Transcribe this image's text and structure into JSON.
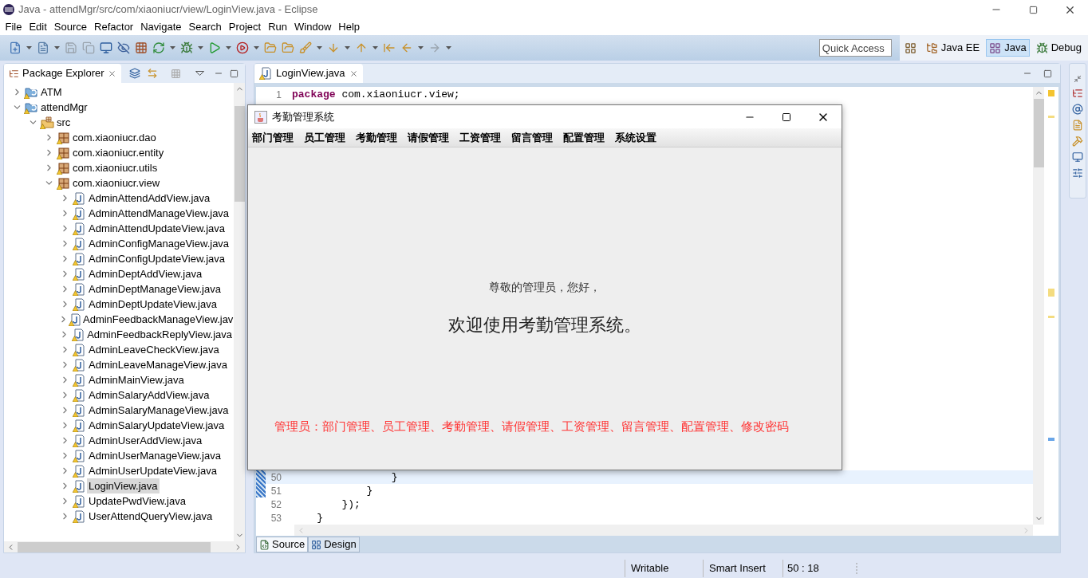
{
  "window": {
    "title": "Java - attendMgr/src/com/xiaoniucr/view/LoginView.java - Eclipse"
  },
  "menu": [
    "File",
    "Edit",
    "Source",
    "Refactor",
    "Navigate",
    "Search",
    "Project",
    "Run",
    "Window",
    "Help"
  ],
  "toolbar": {
    "quick_access": {
      "placeholder": "Quick Access"
    },
    "perspectives": [
      {
        "label": "Java EE",
        "kind": "javaee",
        "selected": false
      },
      {
        "label": "Java",
        "kind": "java",
        "selected": true
      },
      {
        "label": "Debug",
        "kind": "debug",
        "selected": false
      }
    ]
  },
  "package_explorer": {
    "title": "Package Explorer",
    "tree": [
      {
        "label": "ATM",
        "kind": "project",
        "expanded": false,
        "selected": false
      },
      {
        "label": "attendMgr",
        "kind": "project",
        "expanded": true,
        "selected": false,
        "children": [
          {
            "label": "src",
            "kind": "source_folder",
            "expanded": true,
            "selected": false,
            "children": [
              {
                "label": "com.xiaoniucr.dao",
                "kind": "package",
                "expanded": false,
                "selected": false
              },
              {
                "label": "com.xiaoniucr.entity",
                "kind": "package",
                "expanded": false,
                "selected": false
              },
              {
                "label": "com.xiaoniucr.utils",
                "kind": "package",
                "expanded": false,
                "selected": false
              },
              {
                "label": "com.xiaoniucr.view",
                "kind": "package",
                "expanded": true,
                "selected": false,
                "children": [
                  {
                    "label": "AdminAttendAddView.java",
                    "kind": "file",
                    "expanded": false,
                    "selected": false
                  },
                  {
                    "label": "AdminAttendManageView.java",
                    "kind": "file",
                    "expanded": false,
                    "selected": false
                  },
                  {
                    "label": "AdminAttendUpdateView.java",
                    "kind": "file",
                    "expanded": false,
                    "selected": false
                  },
                  {
                    "label": "AdminConfigManageView.java",
                    "kind": "file",
                    "expanded": false,
                    "selected": false
                  },
                  {
                    "label": "AdminConfigUpdateView.java",
                    "kind": "file",
                    "expanded": false,
                    "selected": false
                  },
                  {
                    "label": "AdminDeptAddView.java",
                    "kind": "file",
                    "expanded": false,
                    "selected": false
                  },
                  {
                    "label": "AdminDeptManageView.java",
                    "kind": "file",
                    "expanded": false,
                    "selected": false
                  },
                  {
                    "label": "AdminDeptUpdateView.java",
                    "kind": "file",
                    "expanded": false,
                    "selected": false
                  },
                  {
                    "label": "AdminFeedbackManageView.jav",
                    "kind": "file",
                    "expanded": false,
                    "selected": false
                  },
                  {
                    "label": "AdminFeedbackReplyView.java",
                    "kind": "file",
                    "expanded": false,
                    "selected": false
                  },
                  {
                    "label": "AdminLeaveCheckView.java",
                    "kind": "file",
                    "expanded": false,
                    "selected": false
                  },
                  {
                    "label": "AdminLeaveManageView.java",
                    "kind": "file",
                    "expanded": false,
                    "selected": false
                  },
                  {
                    "label": "AdminMainView.java",
                    "kind": "file",
                    "expanded": false,
                    "selected": false
                  },
                  {
                    "label": "AdminSalaryAddView.java",
                    "kind": "file",
                    "expanded": false,
                    "selected": false
                  },
                  {
                    "label": "AdminSalaryManageView.java",
                    "kind": "file",
                    "expanded": false,
                    "selected": false
                  },
                  {
                    "label": "AdminSalaryUpdateView.java",
                    "kind": "file",
                    "expanded": false,
                    "selected": false
                  },
                  {
                    "label": "AdminUserAddView.java",
                    "kind": "file",
                    "expanded": false,
                    "selected": false
                  },
                  {
                    "label": "AdminUserManageView.java",
                    "kind": "file",
                    "expanded": false,
                    "selected": false
                  },
                  {
                    "label": "AdminUserUpdateView.java",
                    "kind": "file",
                    "expanded": false,
                    "selected": false
                  },
                  {
                    "label": "LoginView.java",
                    "kind": "file",
                    "expanded": false,
                    "selected": true
                  },
                  {
                    "label": "UpdatePwdView.java",
                    "kind": "file",
                    "expanded": false,
                    "selected": false
                  },
                  {
                    "label": "UserAttendQueryView.java",
                    "kind": "file",
                    "expanded": false,
                    "selected": false
                  }
                ]
              }
            ]
          }
        ]
      }
    ]
  },
  "editor": {
    "tabs": [
      {
        "label": "LoginView.java",
        "selected": true
      }
    ],
    "lines_top": [
      {
        "number": "1",
        "current": false,
        "tokens": [
          {
            "text": "package",
            "kind": "keyword"
          },
          {
            "text": " com.xiaoniucr.view;",
            "kind": "plain"
          }
        ]
      }
    ],
    "lines_bottom": [
      {
        "number": "50",
        "current": true,
        "tokens": [
          {
            "text": "                }",
            "kind": "plain"
          }
        ]
      },
      {
        "number": "51",
        "current": false,
        "tokens": [
          {
            "text": "            }",
            "kind": "plain"
          }
        ]
      },
      {
        "number": "52",
        "current": false,
        "tokens": [
          {
            "text": "        });",
            "kind": "plain"
          }
        ]
      },
      {
        "number": "53",
        "current": false,
        "tokens": [
          {
            "text": "    }",
            "kind": "plain"
          }
        ]
      }
    ],
    "bottom_tabs": [
      {
        "label": "Source",
        "kind": "source",
        "selected": true
      },
      {
        "label": "Design",
        "kind": "design",
        "selected": false
      }
    ]
  },
  "dialog": {
    "title": "考勤管理系统",
    "menu": [
      "部门管理",
      "员工管理",
      "考勤管理",
      "请假管理",
      "工资管理",
      "留言管理",
      "配置管理",
      "系统设置"
    ],
    "greeting": "尊敬的管理员，您好，",
    "welcome": "欢迎使用考勤管理系统。",
    "permissions": "管理员：部门管理、员工管理、考勤管理、请假管理、工资管理、留言管理、配置管理、修改密码"
  },
  "status_bar": [
    "Writable",
    "Smart Insert",
    "50 : 18"
  ]
}
